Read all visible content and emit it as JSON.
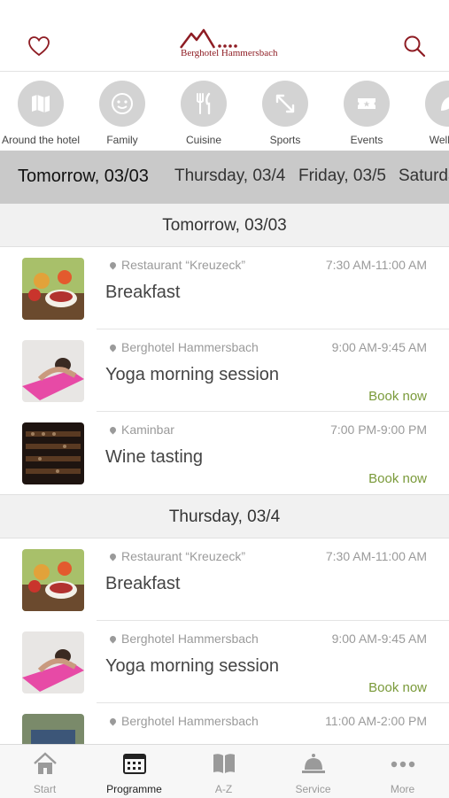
{
  "header": {
    "logo_text": "Berghotel Hammersbach",
    "favorites_icon": "heart-icon",
    "search_icon": "search-icon",
    "accent_color": "#8e1c23"
  },
  "categories": [
    {
      "label": "Around the hotel",
      "icon": "map-icon"
    },
    {
      "label": "Family",
      "icon": "smiley-icon"
    },
    {
      "label": "Cuisine",
      "icon": "cutlery-icon"
    },
    {
      "label": "Sports",
      "icon": "arrows-icon"
    },
    {
      "label": "Events",
      "icon": "ticket-icon"
    },
    {
      "label": "Wellnes",
      "icon": "leaf-icon"
    }
  ],
  "date_tabs": [
    {
      "label": "Tomorrow, 03/03",
      "active": true
    },
    {
      "label": "Thursday, 03/4"
    },
    {
      "label": "Friday, 03/5"
    },
    {
      "label": "Saturda"
    }
  ],
  "days": [
    {
      "header": "Tomorrow, 03/03",
      "events": [
        {
          "location": "Restaurant “Kreuzeck”",
          "time": "7:30 AM-11:00 AM",
          "title": "Breakfast",
          "book": ""
        },
        {
          "location": "Berghotel Hammersbach",
          "time": "9:00 AM-9:45 AM",
          "title": "Yoga morning session",
          "book": "Book now"
        },
        {
          "location": "Kaminbar",
          "time": "7:00 PM-9:00 PM",
          "title": "Wine tasting",
          "book": "Book now"
        }
      ]
    },
    {
      "header": "Thursday, 03/4",
      "events": [
        {
          "location": "Restaurant “Kreuzeck”",
          "time": "7:30 AM-11:00 AM",
          "title": "Breakfast",
          "book": ""
        },
        {
          "location": "Berghotel Hammersbach",
          "time": "9:00 AM-9:45 AM",
          "title": "Yoga morning session",
          "book": "Book now"
        },
        {
          "location": "Berghotel Hammersbach",
          "time": "11:00 AM-2:00 PM",
          "title": "",
          "book": ""
        }
      ]
    }
  ],
  "tabbar": [
    {
      "label": "Start",
      "icon": "home-icon"
    },
    {
      "label": "Programme",
      "icon": "calendar-icon",
      "active": true
    },
    {
      "label": "A-Z",
      "icon": "book-icon"
    },
    {
      "label": "Service",
      "icon": "service-bell-icon"
    },
    {
      "label": "More",
      "icon": "more-dots-icon"
    }
  ],
  "colors": {
    "link": "#7a9a3a",
    "muted": "#9a9a9a"
  }
}
